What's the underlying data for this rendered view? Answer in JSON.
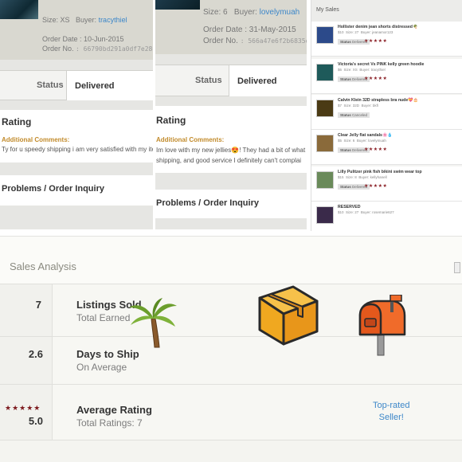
{
  "panel1": {
    "size_label": "Size: XS",
    "buyer_label": "Buyer:",
    "buyer": "tracythiel",
    "order_date": "Order Date : 10-Jun-2015",
    "order_no_label": "Order No.",
    "order_no": ": 66790bd291a0df7e280147",
    "status_label": "Status",
    "status_value": "Delivered",
    "rating_title": "Rating",
    "additional_comments": "Additional Comments:",
    "comment": "Ty for u speedy shipping i am very satisfied with my item",
    "inquiry": "Problems / Order Inquiry"
  },
  "panel2": {
    "size_label": "Size: 6",
    "buyer_label": "Buyer:",
    "buyer": "lovelymuah",
    "order_date": "Order Date : 31-May-2015",
    "order_no_label": "Order No.",
    "order_no": ": 566a47e6f2b6835de",
    "status_label": "Status",
    "status_value": "Delivered",
    "rating_title": "Rating",
    "additional_comments": "Additional Comments:",
    "comment_line1": "Im love with my new jellies😍! They had a bit of what",
    "comment_line2": "shipping, and good service I definitely can't complai",
    "inquiry": "Problems / Order Inquiry"
  },
  "my_sales": {
    "title": "My Sales",
    "items": [
      {
        "name": "Hollister denim jean shorts distressed🌴",
        "price": "$10",
        "size": "Size: 27",
        "buyer": "Buyer: jeanamor123",
        "status_label": "Status",
        "status": "Delivered",
        "stars": "★★★★★",
        "thumb_color": "#2c4a8a"
      },
      {
        "name": "Victoria's secret Vs PINK kelly green hoodie",
        "price": "$6",
        "size": "Size: XS",
        "buyer": "Buyer: tracythiel",
        "status_label": "Status",
        "status": "Delivered",
        "stars": "★★★★★",
        "thumb_color": "#1e5a5a"
      },
      {
        "name": "Calvin Klein 32D strapless bra nude💝🎂",
        "price": "$7",
        "size": "Size: 32D",
        "buyer": "Buyer: bkf\\",
        "status_label": "Status",
        "status": "Canceled",
        "stars": "",
        "thumb_color": "#4a3a14"
      },
      {
        "name": "Clear Jelly flat sandals🌸💧",
        "price": "$5",
        "size": "Size: 6",
        "buyer": "Buyer: lovelymuah",
        "status_label": "Status",
        "status": "Delivered",
        "stars": "★★★★★",
        "thumb_color": "#8a6a3a"
      },
      {
        "name": "Lilly Pulitzer pink fish bikini swim wear top",
        "price": "$15",
        "size": "Size: 8",
        "buyer": "Buyer: kellyhanell",
        "status_label": "Status",
        "status": "Delivered",
        "stars": "★★★★★",
        "thumb_color": "#6a8a5a"
      },
      {
        "name": "RESERVED",
        "price": "$10",
        "size": "Size: 27",
        "buyer": "Buyer: rosemarie627",
        "status_label": "",
        "status": "",
        "stars": "",
        "thumb_color": "#3a2a4a"
      }
    ]
  },
  "sales_analysis": {
    "title": "Sales Analysis",
    "listings_sold": "7",
    "listings_label": "Listings Sold",
    "listings_sub": "Total Earned",
    "days_to_ship": "2.6",
    "days_label": "Days to Ship",
    "days_sub": "On Average",
    "rating_stars": "★★★★★",
    "rating_value": "5.0",
    "rating_label": "Average Rating",
    "rating_sub": "Total Ratings: 7",
    "top_rated_line1": "Top-rated",
    "top_rated_line2": "Seller!"
  },
  "icons": {
    "palm": "palm-tree-icon",
    "box": "package-box-icon",
    "mailbox": "mailbox-icon"
  },
  "colors": {
    "link": "#3d87c9",
    "star": "#8a1f25",
    "accent_gold": "#c28b2c"
  }
}
